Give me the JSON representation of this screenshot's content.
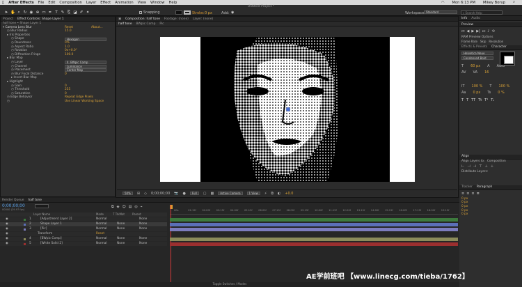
{
  "menubar": {
    "app": "After Effects",
    "items": [
      "File",
      "Edit",
      "Composition",
      "Layer",
      "Effect",
      "Animation",
      "View",
      "Window",
      "Help"
    ],
    "clock": "Mon 6:13 PM",
    "user": "Mikey Borup"
  },
  "window_title": "Untitled Project *",
  "toolbar": {
    "snapping_label": "Snapping",
    "stroke_label": "Stroke:",
    "stroke_value": "0 px",
    "add_label": "Add:",
    "workspace_label": "Workspace:",
    "workspace_value": "Standard",
    "search_placeholder": "Search Help"
  },
  "left_panel": {
    "tab_project": "Project",
    "tab_effect_controls": "Effect Controls: Shape Layer 1",
    "breadcrumb": "half tone • Shape Layer 1",
    "effect_name": "Camera Lens Blur",
    "reset_label": "Reset",
    "about_label": "About...",
    "props": [
      {
        "name": "Blur Radius",
        "value": "15.0",
        "indent": 1
      },
      {
        "name": "Iris Properties",
        "value": "",
        "indent": 1
      },
      {
        "name": "Shape",
        "value": "Hexagon",
        "indent": 2,
        "dropdown": true
      },
      {
        "name": "Roundness",
        "value": "0%",
        "indent": 2
      },
      {
        "name": "Aspect Ratio",
        "value": "1.0",
        "indent": 2
      },
      {
        "name": "Rotation",
        "value": "0x+0.0°",
        "indent": 2
      },
      {
        "name": "Diffraction Fringe",
        "value": "100.0",
        "indent": 2
      },
      {
        "name": "Blur Map",
        "value": "",
        "indent": 1
      },
      {
        "name": "Layer",
        "value": "4. BWpic Comp",
        "indent": 2,
        "dropdown": true
      },
      {
        "name": "Channel",
        "value": "Luminance",
        "indent": 2,
        "dropdown": true
      },
      {
        "name": "Placement",
        "value": "Center Map",
        "indent": 2,
        "dropdown": true
      },
      {
        "name": "Blur Focal Distance",
        "value": "0",
        "indent": 2
      },
      {
        "name": "Invert Blur Map",
        "value": "",
        "indent": 2
      },
      {
        "name": "Highlight",
        "value": "",
        "indent": 1
      },
      {
        "name": "Gain",
        "value": "0",
        "indent": 2
      },
      {
        "name": "Threshold",
        "value": "255",
        "indent": 2
      },
      {
        "name": "Saturation",
        "value": "0",
        "indent": 2
      },
      {
        "name": "Edge Behavior",
        "value": "Repeat Edge Pixels",
        "indent": 1
      },
      {
        "name": "",
        "value": "Use Linear Working Space",
        "indent": 1
      }
    ]
  },
  "viewer": {
    "tab_composition": "Composition: half tone",
    "tab_footage": "Footage: (none)",
    "tab_layer": "Layer: (none)",
    "sub_tabs": [
      "half tone",
      "BWpic Comp",
      "Pic"
    ],
    "zoom": "50%",
    "timecode": "0;00;00;00",
    "resolution": "Full",
    "camera": "Active Camera",
    "view": "1 View",
    "exposure": "+0.0"
  },
  "timeline": {
    "tab_render": "Render Queue",
    "tab_comp": "half tone",
    "timecode": "0;00;00;00",
    "fps": "00000 (29.97 fps)",
    "columns": [
      "Layer Name",
      "Mode",
      "T TrkMat",
      "Parent"
    ],
    "ruler": [
      "00s",
      "01:15f",
      "02:00f",
      "03:15f",
      "04:00f",
      "05:15f",
      "06:00f",
      "07:15f",
      "08:00f",
      "09:15f",
      "10:00f",
      "11:15f",
      "12:00f",
      "13:15f",
      "14:00f",
      "15:15f",
      "16:00f",
      "17:15f",
      "18:00f",
      "19:15f"
    ],
    "layers": [
      {
        "num": "1",
        "name": "[Adjustment Layer 2]",
        "mode": "Normal",
        "trk": "",
        "parent": "None",
        "color": "#3d7a3d"
      },
      {
        "num": "2",
        "name": "Shape Layer 1",
        "mode": "Normal",
        "trk": "None",
        "parent": "None",
        "color": "#5b6fb8"
      },
      {
        "num": "3",
        "name": "[Pic]",
        "mode": "Normal",
        "trk": "None",
        "parent": "None",
        "color": "#7c7cbd"
      },
      {
        "num": "",
        "name": "Transform",
        "mode": "Reset",
        "trk": "",
        "parent": "",
        "color": ""
      },
      {
        "num": "4",
        "name": "[BWpic Comp]",
        "mode": "Normal",
        "trk": "None",
        "parent": "None",
        "color": "#8b8b5a"
      },
      {
        "num": "5",
        "name": "[White Solid 2]",
        "mode": "Normal",
        "trk": "None",
        "parent": "None",
        "color": "#9b2f2f"
      }
    ],
    "footer": "Toggle Switches / Modes"
  },
  "right_panel": {
    "info_tab": "Info",
    "audio_tab": "Audio",
    "preview_tab": "Preview",
    "ram_preview": "RAM Preview Options",
    "frame_rate": "Frame Rate",
    "skip": "Skip",
    "resolution": "Resolution",
    "effects_tab": "Effects & Presets",
    "character_tab": "Character",
    "font": "Helvetica Neue",
    "font_style": "Condensed Bold",
    "size_value": "60 px",
    "leading_value": "Auto",
    "tracking_value": "16",
    "scale_v": "100 %",
    "scale_h": "100 %",
    "baseline": "0 px",
    "tsume": "0 %",
    "align_tab": "Align",
    "align_layers_to": "Align Layers to:",
    "align_target": "Composition",
    "distribute": "Distribute Layers:",
    "tracker_tab": "Tracker",
    "paragraph_tab": "Paragraph",
    "para_values": [
      "0 px",
      "0 px",
      "0 px",
      "0 px",
      "0 px"
    ]
  },
  "watermark": "AE学前班吧 【www.linecg.com/tieba/1762】",
  "colors": {
    "accent": "#dca437",
    "bg": "#2e2e2e"
  }
}
